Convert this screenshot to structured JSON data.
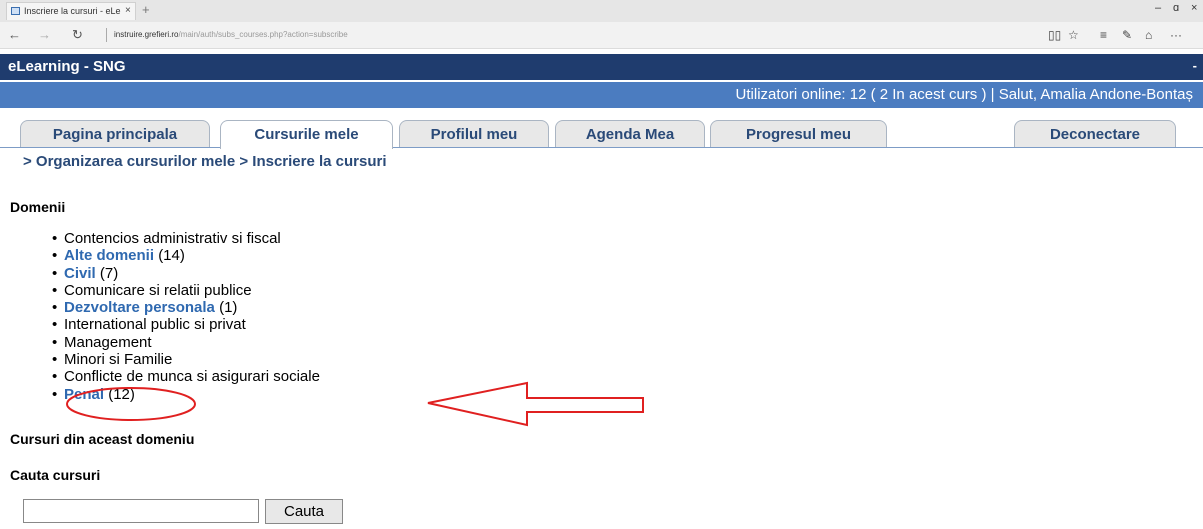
{
  "browser": {
    "tab_title": "Inscriere la cursuri - eLe",
    "tab_close": "×",
    "new_tab": "+",
    "url_host": "instruire.grefieri.ro",
    "url_path": "/main/auth/subs_courses.php?action=subscribe",
    "minimize": "–",
    "restore": "ɑ",
    "close": "×"
  },
  "site": {
    "title": "eLearning - SNG",
    "header_dash": "-",
    "online_info": "Utilizatori online:  12  ( 2 In acest curs  ) | Salut, Amalia Andone-Bontaș"
  },
  "tabs": [
    {
      "label": "Pagina principala",
      "active": false
    },
    {
      "label": "Cursurile mele",
      "active": true
    },
    {
      "label": "Profilul meu",
      "active": false
    },
    {
      "label": "Agenda Mea",
      "active": false
    },
    {
      "label": "Progresul meu",
      "active": false
    },
    {
      "label": "Deconectare",
      "active": false
    }
  ],
  "breadcrumb": {
    "item1": "> Organizarea cursurilor mele",
    "item2": "> Inscriere la cursuri"
  },
  "domains": {
    "heading": "Domenii",
    "items": [
      {
        "label": "Contencios administrativ si fiscal",
        "count": "",
        "link": false
      },
      {
        "label": "Alte domenii",
        "count": "(14)",
        "link": true
      },
      {
        "label": "Civil",
        "count": "(7)",
        "link": true
      },
      {
        "label": "Comunicare si relatii publice",
        "count": "",
        "link": false
      },
      {
        "label": "Dezvoltare personala",
        "count": "(1)",
        "link": true
      },
      {
        "label": "International public si privat",
        "count": "",
        "link": false
      },
      {
        "label": "Management",
        "count": "",
        "link": false
      },
      {
        "label": "Minori si Familie",
        "count": "",
        "link": false
      },
      {
        "label": "Conflicte de munca si asigurari sociale",
        "count": "",
        "link": false
      },
      {
        "label": "Penal",
        "count": "(12)",
        "link": true
      }
    ]
  },
  "courses_heading": "Cursuri din aceast domeniu",
  "search": {
    "heading": "Cauta cursuri",
    "value": "",
    "button": "Cauta"
  },
  "colors": {
    "header_bg": "#1f3c6e",
    "infobar_bg": "#4b7cc0",
    "link": "#2f69b0",
    "annotation": "#e02020"
  }
}
